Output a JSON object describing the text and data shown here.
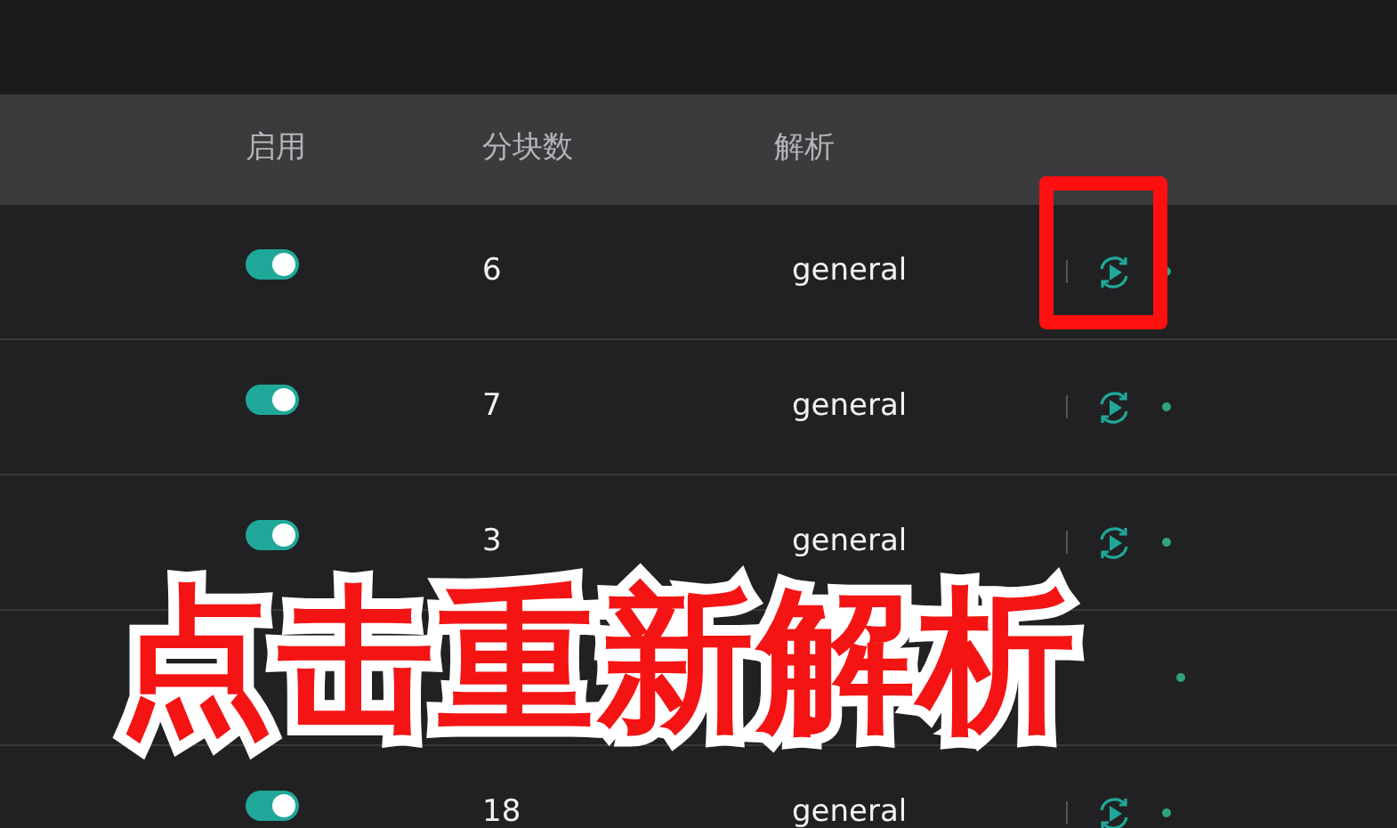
{
  "table": {
    "columns": [
      "启用",
      "分块数",
      "解析"
    ],
    "rows": [
      {
        "kind": "full",
        "enabled": true,
        "chunks": "6",
        "parser": "general",
        "highlighted": true
      },
      {
        "kind": "full",
        "enabled": true,
        "chunks": "7",
        "parser": "general",
        "highlighted": false
      },
      {
        "kind": "full",
        "enabled": true,
        "chunks": "3",
        "parser": "general",
        "highlighted": false
      },
      {
        "kind": "covered"
      },
      {
        "kind": "full",
        "enabled": true,
        "chunks": "18",
        "parser": "general",
        "highlighted": false
      }
    ]
  },
  "annotation": {
    "text": "点击重新解析"
  }
}
